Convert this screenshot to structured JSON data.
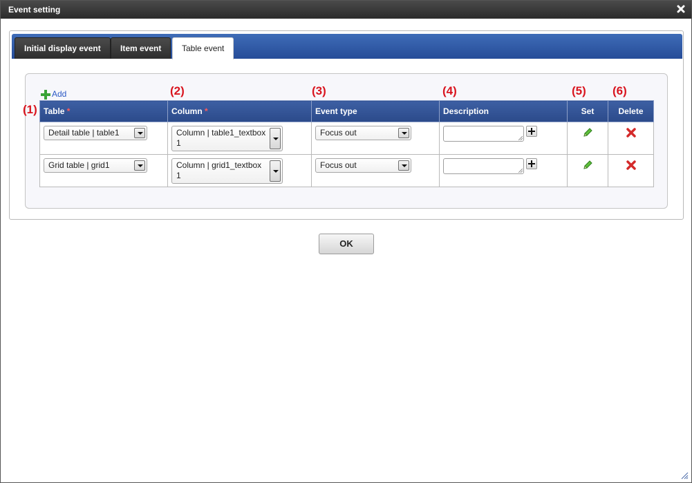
{
  "dialog": {
    "title": "Event setting"
  },
  "tabs": [
    {
      "label": "Initial display event",
      "active": false
    },
    {
      "label": "Item event",
      "active": false
    },
    {
      "label": "Table event",
      "active": true
    }
  ],
  "toolbar": {
    "add_label": "Add"
  },
  "annotations": [
    "(1)",
    "(2)",
    "(3)",
    "(4)",
    "(5)",
    "(6)"
  ],
  "table": {
    "columns": [
      "Table",
      "Column",
      "Event type",
      "Description",
      "Set",
      "Delete"
    ],
    "required_marker": "*",
    "rows": [
      {
        "table": "Detail table | table1",
        "column": "Column | table1_textbox 1",
        "event_type": "Focus out",
        "description": ""
      },
      {
        "table": "Grid table | grid1",
        "column": "Column | grid1_textbox 1",
        "event_type": "Focus out",
        "description": ""
      }
    ]
  },
  "footer": {
    "ok_label": "OK"
  },
  "colors": {
    "tab_bar": "#2b4f9c",
    "header": "#2f4f8f",
    "annotation": "#d9141e",
    "edit_icon": "#3aa337",
    "delete_icon": "#d42a2a"
  },
  "icons": {
    "close": "close-icon",
    "add": "plus-icon",
    "set": "pencil-icon",
    "delete": "x-icon"
  }
}
